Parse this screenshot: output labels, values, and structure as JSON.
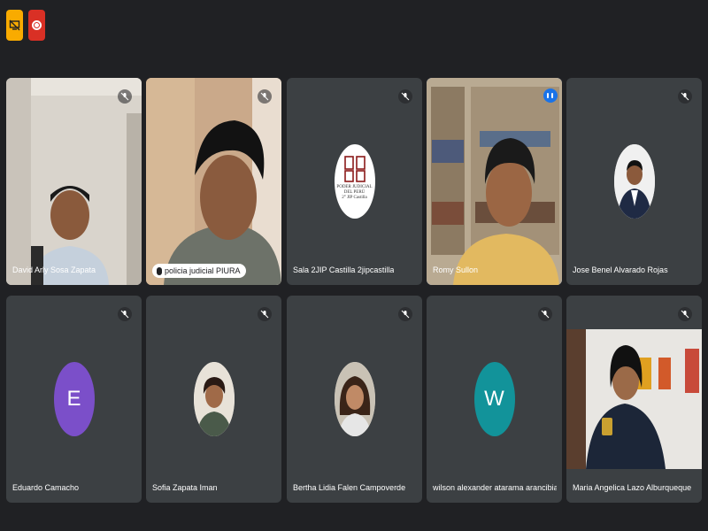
{
  "participants": [
    {
      "name": "David Arly Sosa Zapata"
    },
    {
      "name": "policia judicial PIURA"
    },
    {
      "name": "Sala 2JIP Castilla 2jipcastilla"
    },
    {
      "name": "Romy Sullon"
    },
    {
      "name": "Jose Benel Alvarado Rojas"
    },
    {
      "name": "Eduardo Camacho",
      "initial": "E",
      "color": "#7b4fc9"
    },
    {
      "name": "Sofia Zapata Iman"
    },
    {
      "name": "Bertha Lidia Falen Campoverde"
    },
    {
      "name": "wilson alexander atarama arancibia",
      "initial": "W",
      "color": "#12939a"
    },
    {
      "name": "Maria Angelica Lazo Alburqueque"
    }
  ],
  "logo": {
    "line1": "PODER JUDICIAL",
    "line2": "DEL PERÚ",
    "line3": "2° JIP Castilla"
  },
  "colors": {
    "speaking_border": "#8ab4f8",
    "tile_bg": "#3c4043",
    "page_bg": "#202124"
  },
  "icons": {
    "top_left": "presentation-off-icon",
    "recording": "recording-icon",
    "muted": "mic-off-icon",
    "speaking": "audio-level-icon"
  }
}
